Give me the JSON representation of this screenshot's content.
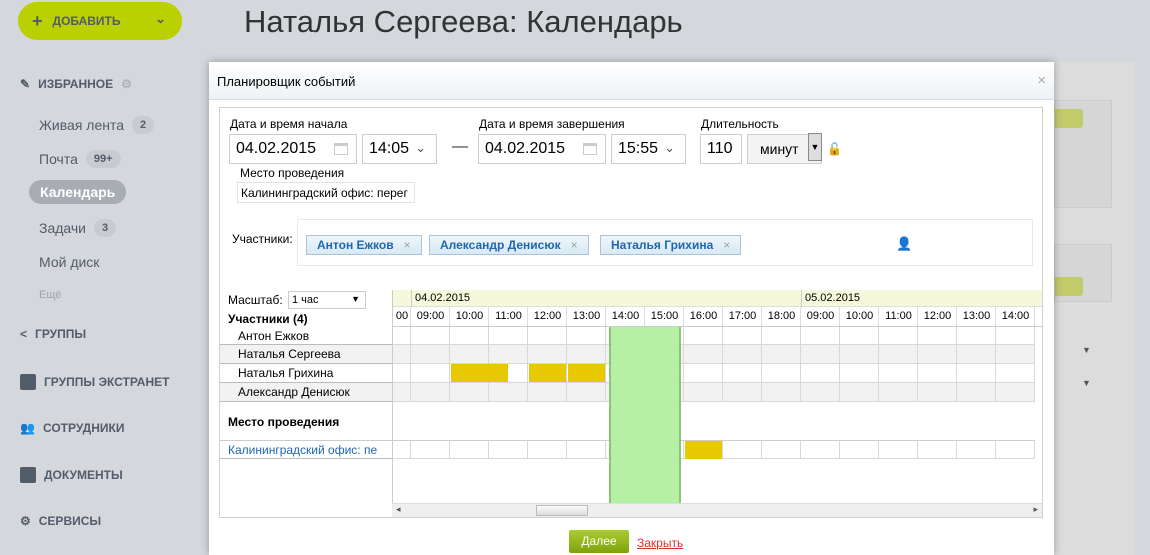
{
  "page_title": "Наталья Сергеева: Календарь",
  "add_button": "ДОБАВИТЬ",
  "sidebar": {
    "favorites": "ИЗБРАННОЕ",
    "items": [
      {
        "label": "Живая лента",
        "badge": "2"
      },
      {
        "label": "Почта",
        "badge": "99+"
      },
      {
        "label": "Календарь",
        "badge": ""
      },
      {
        "label": "Задачи",
        "badge": "3"
      },
      {
        "label": "Мой диск",
        "badge": ""
      }
    ],
    "more": "Ещё",
    "sections": [
      "ГРУППЫ",
      "ГРУППЫ ЭКСТРАНЕТ",
      "СОТРУДНИКИ",
      "ДОКУМЕНТЫ",
      "СЕРВИСЫ"
    ]
  },
  "dialog": {
    "title": "Планировщик событий",
    "start_label": "Дата и время начала",
    "start_date": "04.02.2015",
    "start_time": "14:05",
    "dash": "—",
    "end_label": "Дата и время завершения",
    "end_date": "04.02.2015",
    "end_time": "15:55",
    "duration_label": "Длительность",
    "duration_value": "110",
    "duration_unit": "минут",
    "location_label": "Место проведения",
    "location_value": "Калининградский офис: перег",
    "participants_label": "Участники:",
    "participants": [
      "Антон Ежков",
      "Александр Денисюк",
      "Наталья Грихина"
    ],
    "scale_label": "Масштаб:",
    "scale_value": "1 час",
    "members_header": "Участники (4)",
    "members": [
      "Антон Ежков",
      "Наталья Сергеева",
      "Наталья Грихина",
      "Александр Денисюк"
    ],
    "place_header": "Место проведения",
    "place_row": "Калининградский офис: пе",
    "dates": [
      "04.02.2015",
      "05.02.2015"
    ],
    "hours_day1": [
      "09:00",
      "10:00",
      "11:00",
      "12:00",
      "13:00",
      "14:00",
      "15:00",
      "16:00",
      "17:00",
      "18:00"
    ],
    "hours_day2": [
      "09:00",
      "10:00",
      "11:00",
      "12:00",
      "13:00",
      "14:00"
    ],
    "partial_hour": "00",
    "selection": {
      "start": 14.083,
      "end": 15.917
    },
    "busy": [
      {
        "row": 2,
        "start": 10,
        "end": 11.5
      },
      {
        "row": 2,
        "start": 12,
        "end": 13
      },
      {
        "row": 2,
        "start": 13,
        "end": 14
      },
      {
        "row": "place",
        "start": 16,
        "end": 17
      }
    ],
    "next_button": "Далее",
    "close_link": "Закрыть"
  },
  "colors": {
    "accent": "#bbd000",
    "busy": "#e6c900",
    "selection": "#b3f0a0",
    "link": "#2067b0"
  }
}
